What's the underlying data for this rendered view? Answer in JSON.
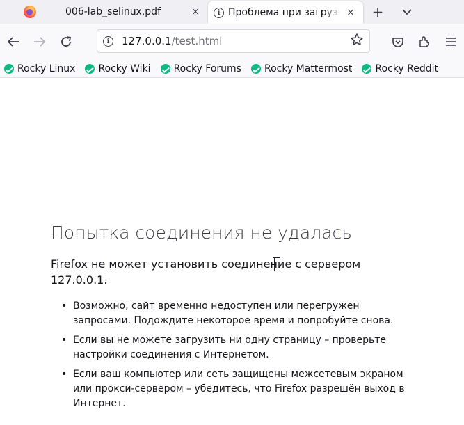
{
  "tabs": [
    {
      "title": "006-lab_selinux.pdf",
      "active": false
    },
    {
      "title": "Проблема при загрузке страницы",
      "active": true
    }
  ],
  "tab_close_glyph": "×",
  "new_tab_glyph": "+",
  "tab_list_glyph": "⌄",
  "url": {
    "host": "127.0.0.1",
    "path": "/test.html"
  },
  "bookmarks": [
    "Rocky Linux",
    "Rocky Wiki",
    "Rocky Forums",
    "Rocky Mattermost",
    "Rocky Reddit"
  ],
  "error": {
    "title": "Попытка соединения не удалась",
    "description": "Firefox не может установить соединение с сервером 127.0.0.1.",
    "tips": [
      "Возможно, сайт временно недоступен или перегружен запросами. Подождите некоторое время и попробуйте снова.",
      "Если вы не можете загрузить ни одну страницу – проверьте настройки соединения с Интернетом.",
      "Если ваш компьютер или сеть защищены межсетевым экраном или прокси-сервером – убедитесь, что Firefox разрешён выход в Интернет."
    ]
  },
  "icons": {
    "back": "back-arrow-icon",
    "forward": "forward-arrow-icon",
    "reload": "reload-icon",
    "info": "info-icon",
    "bookmark_star": "star-icon",
    "pocket": "pocket-icon",
    "extensions": "extensions-icon",
    "menu": "hamburger-menu-icon",
    "bookmark_favicon": "rocky-logo-icon"
  },
  "colors": {
    "accent_bookmark": "#10b981",
    "tabstrip_bg": "#f0f0f4",
    "toolbar_bg": "#f9f9fb"
  }
}
